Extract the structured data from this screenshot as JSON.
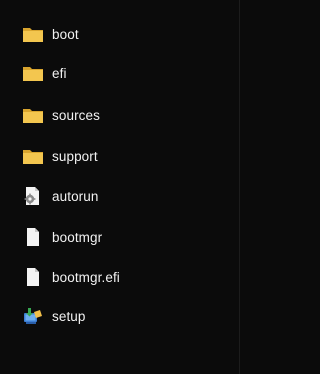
{
  "explorer": {
    "items": [
      {
        "name": "boot",
        "kind": "folder",
        "icon": "folder-icon"
      },
      {
        "name": "efi",
        "kind": "folder",
        "icon": "folder-icon"
      },
      {
        "name": "sources",
        "kind": "folder",
        "icon": "folder-icon"
      },
      {
        "name": "support",
        "kind": "folder",
        "icon": "folder-icon"
      },
      {
        "name": "autorun",
        "kind": "setup-information",
        "icon": "settings-file-icon"
      },
      {
        "name": "bootmgr",
        "kind": "file",
        "icon": "blank-file-icon"
      },
      {
        "name": "bootmgr.efi",
        "kind": "file",
        "icon": "blank-file-icon"
      },
      {
        "name": "setup",
        "kind": "application",
        "icon": "installer-icon"
      }
    ]
  },
  "colors": {
    "background": "#0b0b0b",
    "text": "#f2f2f2",
    "folder": "#f0c04a",
    "file": "#f4f4f4"
  }
}
